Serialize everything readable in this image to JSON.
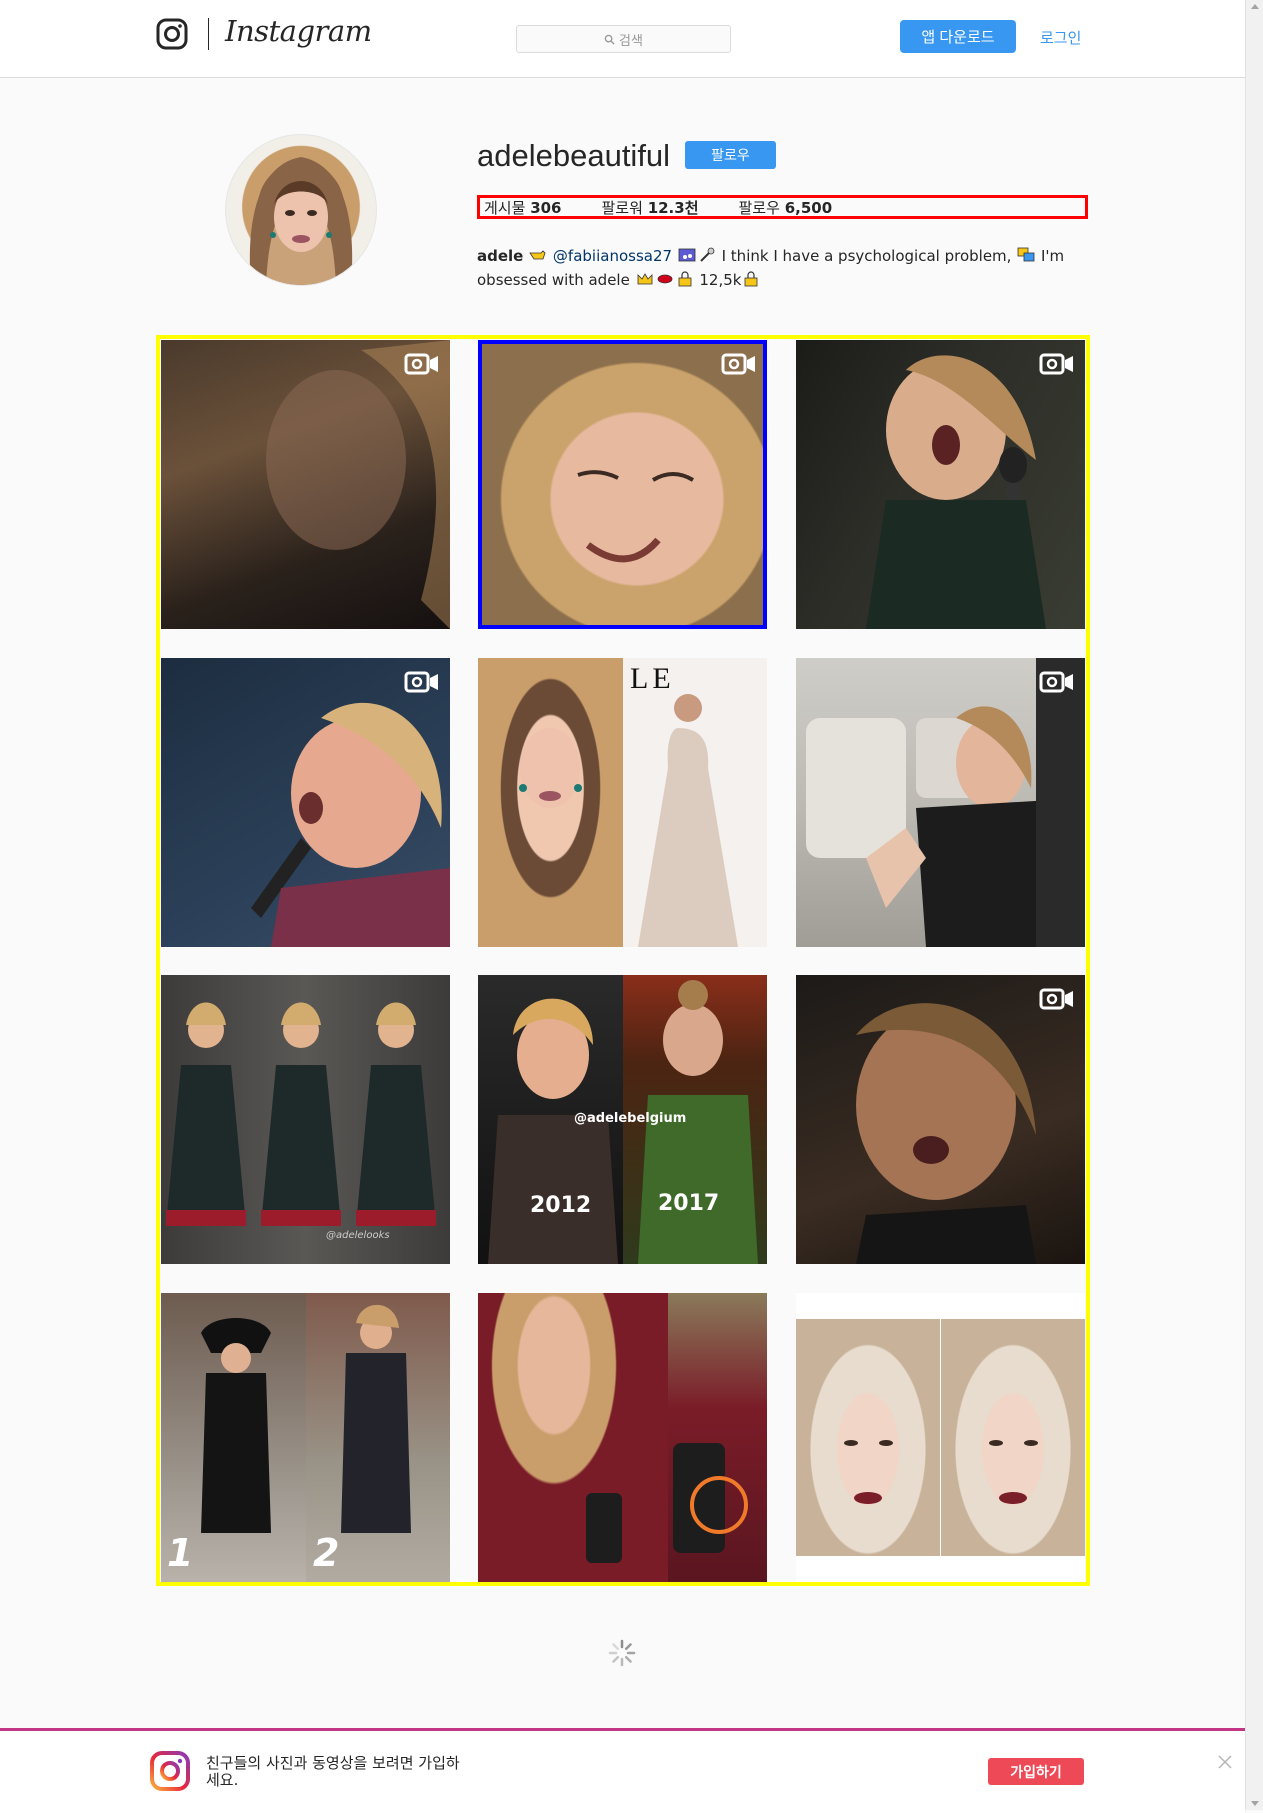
{
  "header": {
    "logo_text": "Instagram",
    "search_placeholder": "검색",
    "download_button": "앱 다운로드",
    "login_link": "로그인"
  },
  "profile": {
    "username": "adelebeautiful",
    "follow_button": "팔로우",
    "stats": [
      {
        "label": "게시물",
        "value": "306"
      },
      {
        "label": "팔로워",
        "value": "12.3천"
      },
      {
        "label": "팔로우",
        "value": "6,500"
      }
    ],
    "bio": {
      "name": "adele",
      "mention": "@fabiianossa27",
      "text1": "I think I have a psychological problem,",
      "text2": "I'm obsessed with adele",
      "count": "12,5k"
    }
  },
  "grid": {
    "posts": [
      {
        "video": true,
        "caption": ""
      },
      {
        "video": true,
        "caption": ""
      },
      {
        "video": true,
        "caption": ""
      },
      {
        "video": true,
        "caption": ""
      },
      {
        "video": false,
        "caption": "LE"
      },
      {
        "video": true,
        "caption": ""
      },
      {
        "video": false,
        "caption": "@adelelooks"
      },
      {
        "video": false,
        "caption": "@adelebelgium",
        "labels": [
          "2012",
          "2017"
        ]
      },
      {
        "video": true,
        "caption": ""
      },
      {
        "video": false,
        "caption": "",
        "labels": [
          "1",
          "2"
        ]
      },
      {
        "video": false,
        "caption": ""
      },
      {
        "video": false,
        "caption": ""
      }
    ]
  },
  "banner": {
    "text": "친구들의 사진과 동영상을 보려면 가입하세요.",
    "signup_button": "가입하기"
  },
  "colors": {
    "accent": "#3897f0",
    "signup": "#ed4956",
    "highlight_stats": "#ff0000",
    "highlight_grid": "#ffff00",
    "highlight_selected": "#0000ff"
  }
}
